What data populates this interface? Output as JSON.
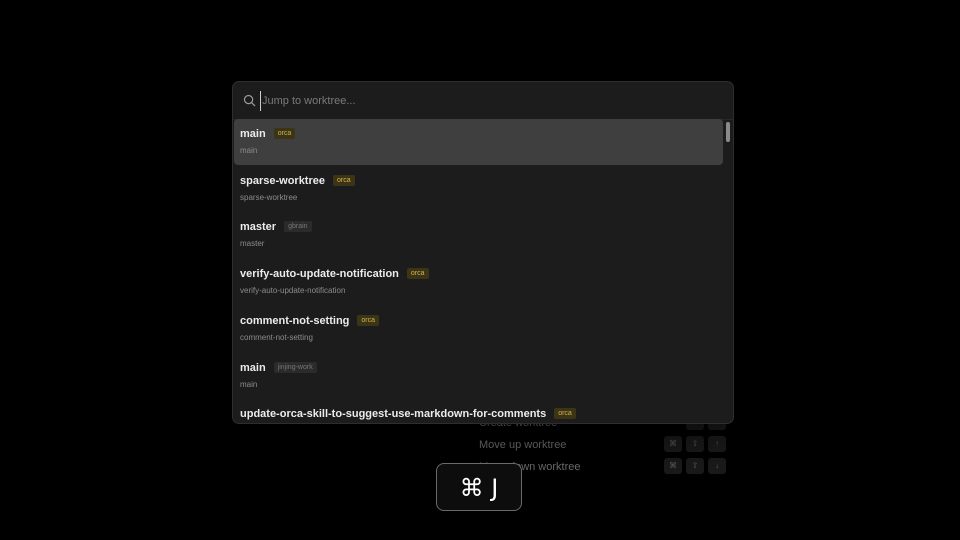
{
  "search": {
    "placeholder": "Jump to worktree..."
  },
  "worktrees": [
    {
      "name": "main",
      "repo": "orca",
      "path": "main",
      "selected": true,
      "badge_style": "orca"
    },
    {
      "name": "sparse-worktree",
      "repo": "orca",
      "path": "sparse-worktree",
      "selected": false,
      "badge_style": "orca"
    },
    {
      "name": "master",
      "repo": "gbrain",
      "path": "master",
      "selected": false,
      "badge_style": "gray"
    },
    {
      "name": "verify-auto-update-notification",
      "repo": "orca",
      "path": "verify-auto-update-notification",
      "selected": false,
      "badge_style": "orca"
    },
    {
      "name": "comment-not-setting",
      "repo": "orca",
      "path": "comment-not-setting",
      "selected": false,
      "badge_style": "orca"
    },
    {
      "name": "main",
      "repo": "jinjing-work",
      "path": "main",
      "selected": false,
      "badge_style": "gray"
    },
    {
      "name": "update-orca-skill-to-suggest-use-markdown-for-comments",
      "repo": "orca",
      "path": "",
      "selected": false,
      "badge_style": "orca"
    }
  ],
  "background_shortcuts": [
    {
      "label": "Create worktree",
      "keys": [
        "⌘",
        "N"
      ]
    },
    {
      "label": "Move up worktree",
      "keys": [
        "⌘",
        "⇧",
        "↑"
      ]
    },
    {
      "label": "Move down worktree",
      "keys": [
        "⌘",
        "⇧",
        "↓"
      ]
    }
  ],
  "key_hint": {
    "label": "⌘ J"
  },
  "colors": {
    "background": "#000000",
    "palette_bg": "#1c1c1c",
    "selected_row": "#3f3f3f",
    "orca_badge_text": "#d4b44a",
    "orca_badge_bg": "#3b3417"
  },
  "icons": {
    "search": "search-icon"
  }
}
